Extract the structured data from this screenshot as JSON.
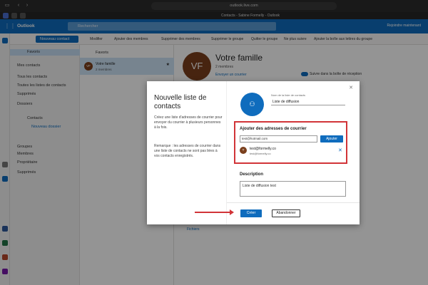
{
  "browser": {
    "url": "outlook.live.com",
    "tab_title": "Contacts - Sabine Formelly - Outlook"
  },
  "appbar": {
    "app_name": "Outlook",
    "search_placeholder": "Rechercher",
    "right_label": "Rejoindre maintenant"
  },
  "toolbar": {
    "new_contact": "Nouveau contact",
    "items": [
      "Modifier",
      "Ajouter des membres",
      "Supprimer des membres",
      "Supprimer le groupe",
      "Quitter le groupe",
      "Ne plus suivre",
      "Ajouter la boîte aux lettres du groupe"
    ]
  },
  "leftnav": {
    "favorites": "Favoris",
    "my_contacts": "Mes contacts",
    "all_contacts": "Tous les contacts",
    "all_lists": "Toutes les listes de contacts",
    "deleted": "Supprimés",
    "folders": "Dossiers",
    "contacts": "Contacts",
    "new_folder": "Nouveau dossier",
    "groups": "Groupes",
    "members": "Membres",
    "owner": "Propriétaire",
    "deleted2": "Supprimés"
  },
  "listpane": {
    "header": "Favoris",
    "item_title": "Votre famille",
    "item_sub": "2 membres",
    "initials": "VF"
  },
  "detail": {
    "initials": "VF",
    "title": "Votre famille",
    "sub": "2 membres",
    "send_email": "Envoyer un courrier",
    "follow": "Suivre dans la boîte de réception",
    "files": "Fichiers"
  },
  "dialog": {
    "title": "Nouvelle liste de contacts",
    "description1": "Créez une liste d'adresses de courrier pour envoyer du courrier à plusieurs personnes à la fois.",
    "description2": "Remarque : les adresses de courrier dans une liste de contacts ne sont pas liées à vos contacts enregistrés.",
    "list_name_label": "Nom de la liste de contacts",
    "list_name_value": "Liste de diffusion",
    "add_heading": "Ajouter des adresses de courrier",
    "email_input_value": "test@hotmail.com",
    "add_button": "Ajouter",
    "member_initial": "T",
    "member_name": "test@formelly.co",
    "member_email": "test@formelly.co",
    "description_heading": "Description",
    "description_value": "Liste de diffusion test",
    "create_button": "Créer",
    "cancel_button": "Abandonner"
  },
  "colors": {
    "accent": "#0f6cbd",
    "highlight": "#d13438",
    "avatar": "#7a3f1d"
  }
}
